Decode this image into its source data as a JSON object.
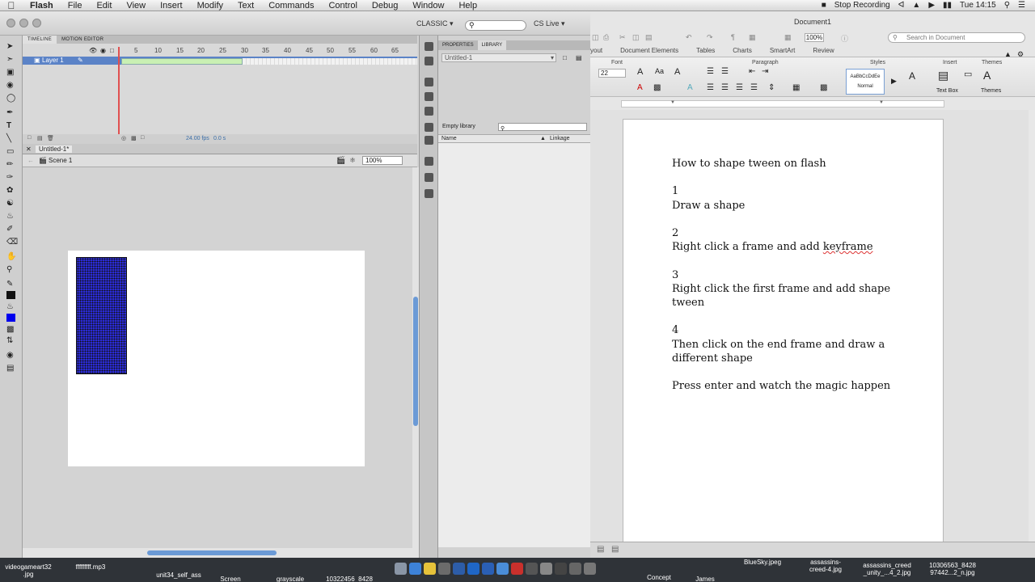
{
  "menubar": {
    "app": "Flash",
    "items": [
      "File",
      "Edit",
      "View",
      "Insert",
      "Modify",
      "Text",
      "Commands",
      "Control",
      "Debug",
      "Window",
      "Help"
    ],
    "recording": "Stop Recording",
    "clock": "Tue 14:15"
  },
  "flash": {
    "workspace": "CLASSIC",
    "cs_live": "CS Live",
    "timeline_tabs": [
      "TIMELINE",
      "MOTION EDITOR"
    ],
    "frame_numbers": [
      "5",
      "10",
      "15",
      "20",
      "25",
      "30",
      "35",
      "40",
      "45",
      "50",
      "55",
      "60",
      "65"
    ],
    "layer_name": "Layer 1",
    "fps": "24.00 fps",
    "time": "0.0 s",
    "doc_tab": "Untitled-1*",
    "scene": "Scene 1",
    "zoom": "100%",
    "panel_tabs": [
      "PROPERTIES",
      "LIBRARY"
    ],
    "library_select": "Untitled-1",
    "library_empty": "Empty library",
    "library_columns": [
      "Name",
      "Linkage"
    ],
    "shape_color": "#2b2bd6"
  },
  "word": {
    "title": "Document1",
    "zoom": "100%",
    "search_placeholder": "Search in Document",
    "ribbon_tabs": [
      "yout",
      "Document Elements",
      "Tables",
      "Charts",
      "SmartArt",
      "Review"
    ],
    "groups": [
      "Font",
      "Paragraph",
      "Styles",
      "Insert",
      "Themes"
    ],
    "font_size": "22",
    "style_sample": "AaBbCcDdEe",
    "style_name": "Normal",
    "textbox_label": "Text Box",
    "themes_label": "Themes",
    "doc_lines": [
      "How to shape tween on flash",
      "",
      "1",
      "Draw a shape",
      "",
      "2",
      "Right click a frame and add keyframe",
      "",
      "3",
      "Right click the first frame and add shape",
      "tween",
      "",
      "4",
      "Then click on the end frame and draw a",
      "different shape",
      "",
      "Press enter and watch the magic happen"
    ]
  },
  "dock": {
    "files": [
      "videogameart32\n.jpg",
      "fffffffff.mp3",
      "unit34_self_ass",
      "Screen",
      "grayscale",
      "10322456_8428",
      "BlueSky.jpeg",
      "assassins-\ncreed-4.jpg",
      "assassins_creed\n_unity_...4_2.jpg",
      "10306563_8428\n97442...2_n.jpg",
      "Concept",
      "James"
    ]
  }
}
